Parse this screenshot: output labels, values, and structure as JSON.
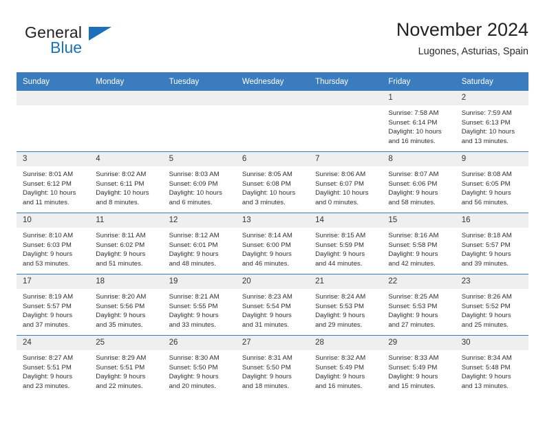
{
  "brand": {
    "name_part1": "General",
    "name_part2": "Blue",
    "flag_icon": "triangle-flag-icon",
    "accent_color": "#1d6fb8"
  },
  "header": {
    "title": "November 2024",
    "subtitle": "Lugones, Asturias, Spain"
  },
  "theme": {
    "header_bg": "#3a7cbe",
    "header_text": "#ffffff",
    "daynum_bg": "#efefef",
    "cell_bg": "#ffffff",
    "grid_line": "#3a7cbe"
  },
  "weekday_headers": [
    "Sunday",
    "Monday",
    "Tuesday",
    "Wednesday",
    "Thursday",
    "Friday",
    "Saturday"
  ],
  "labels": {
    "sunrise": "Sunrise:",
    "sunset": "Sunset:",
    "daylight": "Daylight:"
  },
  "weeks": [
    [
      {
        "day": "",
        "empty": true
      },
      {
        "day": "",
        "empty": true
      },
      {
        "day": "",
        "empty": true
      },
      {
        "day": "",
        "empty": true
      },
      {
        "day": "",
        "empty": true
      },
      {
        "day": "1",
        "sunrise": "Sunrise: 7:58 AM",
        "sunset": "Sunset: 6:14 PM",
        "daylight": "Daylight: 10 hours and 16 minutes."
      },
      {
        "day": "2",
        "sunrise": "Sunrise: 7:59 AM",
        "sunset": "Sunset: 6:13 PM",
        "daylight": "Daylight: 10 hours and 13 minutes."
      }
    ],
    [
      {
        "day": "3",
        "sunrise": "Sunrise: 8:01 AM",
        "sunset": "Sunset: 6:12 PM",
        "daylight": "Daylight: 10 hours and 11 minutes."
      },
      {
        "day": "4",
        "sunrise": "Sunrise: 8:02 AM",
        "sunset": "Sunset: 6:11 PM",
        "daylight": "Daylight: 10 hours and 8 minutes."
      },
      {
        "day": "5",
        "sunrise": "Sunrise: 8:03 AM",
        "sunset": "Sunset: 6:09 PM",
        "daylight": "Daylight: 10 hours and 6 minutes."
      },
      {
        "day": "6",
        "sunrise": "Sunrise: 8:05 AM",
        "sunset": "Sunset: 6:08 PM",
        "daylight": "Daylight: 10 hours and 3 minutes."
      },
      {
        "day": "7",
        "sunrise": "Sunrise: 8:06 AM",
        "sunset": "Sunset: 6:07 PM",
        "daylight": "Daylight: 10 hours and 0 minutes."
      },
      {
        "day": "8",
        "sunrise": "Sunrise: 8:07 AM",
        "sunset": "Sunset: 6:06 PM",
        "daylight": "Daylight: 9 hours and 58 minutes."
      },
      {
        "day": "9",
        "sunrise": "Sunrise: 8:08 AM",
        "sunset": "Sunset: 6:05 PM",
        "daylight": "Daylight: 9 hours and 56 minutes."
      }
    ],
    [
      {
        "day": "10",
        "sunrise": "Sunrise: 8:10 AM",
        "sunset": "Sunset: 6:03 PM",
        "daylight": "Daylight: 9 hours and 53 minutes."
      },
      {
        "day": "11",
        "sunrise": "Sunrise: 8:11 AM",
        "sunset": "Sunset: 6:02 PM",
        "daylight": "Daylight: 9 hours and 51 minutes."
      },
      {
        "day": "12",
        "sunrise": "Sunrise: 8:12 AM",
        "sunset": "Sunset: 6:01 PM",
        "daylight": "Daylight: 9 hours and 48 minutes."
      },
      {
        "day": "13",
        "sunrise": "Sunrise: 8:14 AM",
        "sunset": "Sunset: 6:00 PM",
        "daylight": "Daylight: 9 hours and 46 minutes."
      },
      {
        "day": "14",
        "sunrise": "Sunrise: 8:15 AM",
        "sunset": "Sunset: 5:59 PM",
        "daylight": "Daylight: 9 hours and 44 minutes."
      },
      {
        "day": "15",
        "sunrise": "Sunrise: 8:16 AM",
        "sunset": "Sunset: 5:58 PM",
        "daylight": "Daylight: 9 hours and 42 minutes."
      },
      {
        "day": "16",
        "sunrise": "Sunrise: 8:18 AM",
        "sunset": "Sunset: 5:57 PM",
        "daylight": "Daylight: 9 hours and 39 minutes."
      }
    ],
    [
      {
        "day": "17",
        "sunrise": "Sunrise: 8:19 AM",
        "sunset": "Sunset: 5:57 PM",
        "daylight": "Daylight: 9 hours and 37 minutes."
      },
      {
        "day": "18",
        "sunrise": "Sunrise: 8:20 AM",
        "sunset": "Sunset: 5:56 PM",
        "daylight": "Daylight: 9 hours and 35 minutes."
      },
      {
        "day": "19",
        "sunrise": "Sunrise: 8:21 AM",
        "sunset": "Sunset: 5:55 PM",
        "daylight": "Daylight: 9 hours and 33 minutes."
      },
      {
        "day": "20",
        "sunrise": "Sunrise: 8:23 AM",
        "sunset": "Sunset: 5:54 PM",
        "daylight": "Daylight: 9 hours and 31 minutes."
      },
      {
        "day": "21",
        "sunrise": "Sunrise: 8:24 AM",
        "sunset": "Sunset: 5:53 PM",
        "daylight": "Daylight: 9 hours and 29 minutes."
      },
      {
        "day": "22",
        "sunrise": "Sunrise: 8:25 AM",
        "sunset": "Sunset: 5:53 PM",
        "daylight": "Daylight: 9 hours and 27 minutes."
      },
      {
        "day": "23",
        "sunrise": "Sunrise: 8:26 AM",
        "sunset": "Sunset: 5:52 PM",
        "daylight": "Daylight: 9 hours and 25 minutes."
      }
    ],
    [
      {
        "day": "24",
        "sunrise": "Sunrise: 8:27 AM",
        "sunset": "Sunset: 5:51 PM",
        "daylight": "Daylight: 9 hours and 23 minutes."
      },
      {
        "day": "25",
        "sunrise": "Sunrise: 8:29 AM",
        "sunset": "Sunset: 5:51 PM",
        "daylight": "Daylight: 9 hours and 22 minutes."
      },
      {
        "day": "26",
        "sunrise": "Sunrise: 8:30 AM",
        "sunset": "Sunset: 5:50 PM",
        "daylight": "Daylight: 9 hours and 20 minutes."
      },
      {
        "day": "27",
        "sunrise": "Sunrise: 8:31 AM",
        "sunset": "Sunset: 5:50 PM",
        "daylight": "Daylight: 9 hours and 18 minutes."
      },
      {
        "day": "28",
        "sunrise": "Sunrise: 8:32 AM",
        "sunset": "Sunset: 5:49 PM",
        "daylight": "Daylight: 9 hours and 16 minutes."
      },
      {
        "day": "29",
        "sunrise": "Sunrise: 8:33 AM",
        "sunset": "Sunset: 5:49 PM",
        "daylight": "Daylight: 9 hours and 15 minutes."
      },
      {
        "day": "30",
        "sunrise": "Sunrise: 8:34 AM",
        "sunset": "Sunset: 5:48 PM",
        "daylight": "Daylight: 9 hours and 13 minutes."
      }
    ]
  ]
}
